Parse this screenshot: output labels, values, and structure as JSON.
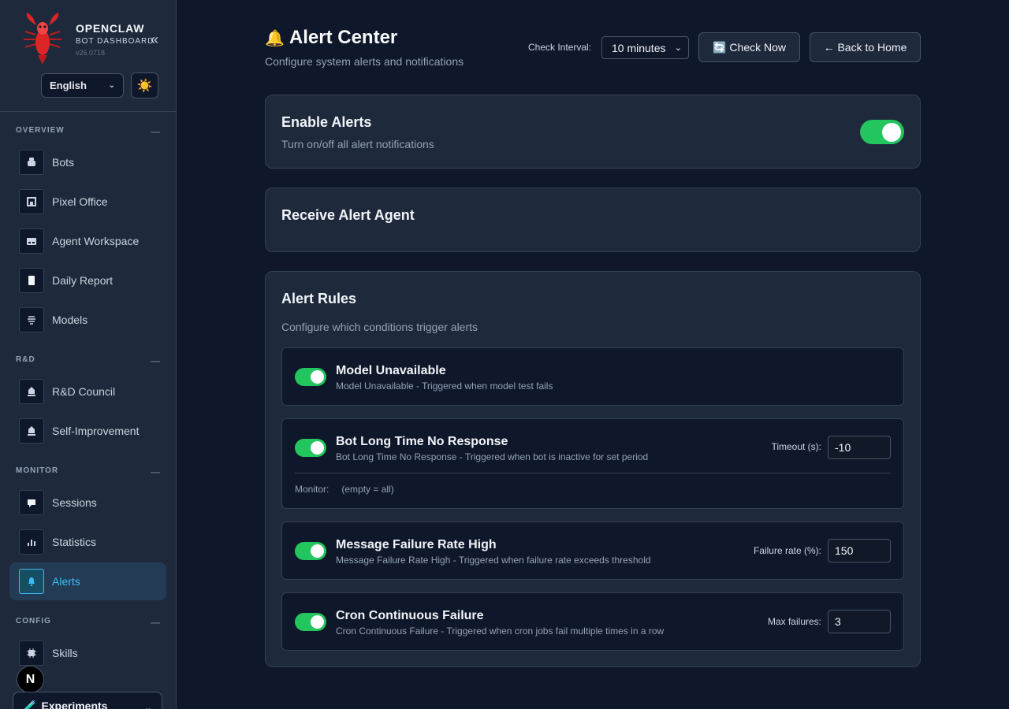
{
  "brand": {
    "name": "OPENCLAW",
    "subtitle": "BOT DASHBOARD",
    "version": "v26.0718"
  },
  "language": "English",
  "sidebar": {
    "sections": [
      {
        "title": "OVERVIEW",
        "items": [
          "Bots",
          "Pixel Office",
          "Agent Workspace",
          "Daily Report",
          "Models"
        ]
      },
      {
        "title": "R&D",
        "items": [
          "R&D Council",
          "Self-Improvement"
        ]
      },
      {
        "title": "MONITOR",
        "items": [
          "Sessions",
          "Statistics",
          "Alerts"
        ]
      },
      {
        "title": "CONFIG",
        "items": [
          "Skills"
        ]
      }
    ],
    "active_item": "Alerts",
    "badge": "N",
    "experiments": "Experiments"
  },
  "header": {
    "title": "Alert Center",
    "subtitle": "Configure system alerts and notifications",
    "check_interval_label": "Check Interval:",
    "check_interval_value": "10 minutes",
    "check_now": "Check Now",
    "back_home": "← Back to Home"
  },
  "enable_alerts": {
    "title": "Enable Alerts",
    "subtitle": "Turn on/off all alert notifications",
    "enabled": true
  },
  "receive_agent": {
    "title": "Receive Alert Agent"
  },
  "rules": {
    "title": "Alert Rules",
    "subtitle": "Configure which conditions trigger alerts",
    "items": [
      {
        "title": "Model Unavailable",
        "desc": "Model Unavailable - Triggered when model test fails",
        "enabled": true
      },
      {
        "title": "Bot Long Time No Response",
        "desc": "Bot Long Time No Response - Triggered when bot is inactive for set period",
        "enabled": true,
        "param_label": "Timeout (s):",
        "param_value": "-10",
        "monitor_label": "Monitor:",
        "monitor_value": "(empty = all)"
      },
      {
        "title": "Message Failure Rate High",
        "desc": "Message Failure Rate High - Triggered when failure rate exceeds threshold",
        "enabled": true,
        "param_label": "Failure rate (%):",
        "param_value": "150"
      },
      {
        "title": "Cron Continuous Failure",
        "desc": "Cron Continuous Failure - Triggered when cron jobs fail multiple times in a row",
        "enabled": true,
        "param_label": "Max failures:",
        "param_value": "3"
      }
    ]
  },
  "colors": {
    "accent": "#38bdf8",
    "toggle_on": "#22c55e",
    "background": "#0f172a",
    "card": "#1e293b"
  }
}
